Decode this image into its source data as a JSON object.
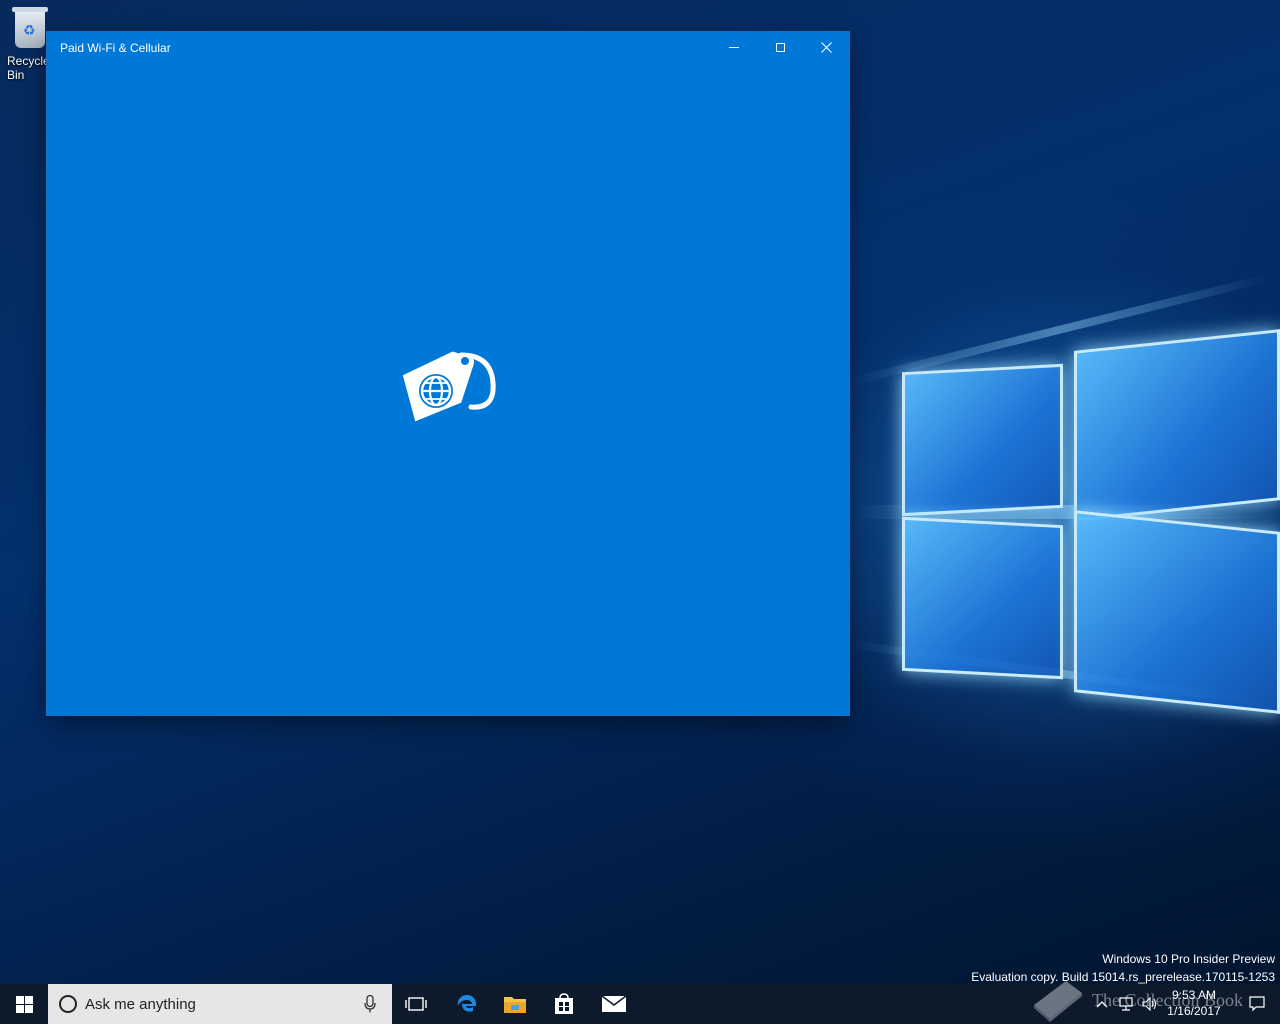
{
  "desktop": {
    "recycle_bin_label": "Recycle Bin",
    "watermark": {
      "line1": "Windows 10 Pro Insider Preview",
      "line2": "Evaluation copy. Build 15014.rs_prerelease.170115-1253"
    },
    "overlay_text": "The Collection Book"
  },
  "window": {
    "title": "Paid Wi-Fi & Cellular",
    "background_color": "#0078d7",
    "splash_icon": "sim-tag-globe-icon",
    "controls": [
      "minimize-icon",
      "maximize-icon",
      "close-icon"
    ]
  },
  "taskbar": {
    "search_placeholder": "Ask me anything",
    "pinned": [
      "task-view-icon",
      "edge-icon",
      "file-explorer-icon",
      "store-icon",
      "mail-icon"
    ],
    "tray_icons": [
      "chevron-up-icon",
      "network-icon",
      "volume-icon"
    ],
    "clock_time": "9:53 AM",
    "clock_date": "1/16/2017",
    "accent": "#0078d7"
  }
}
